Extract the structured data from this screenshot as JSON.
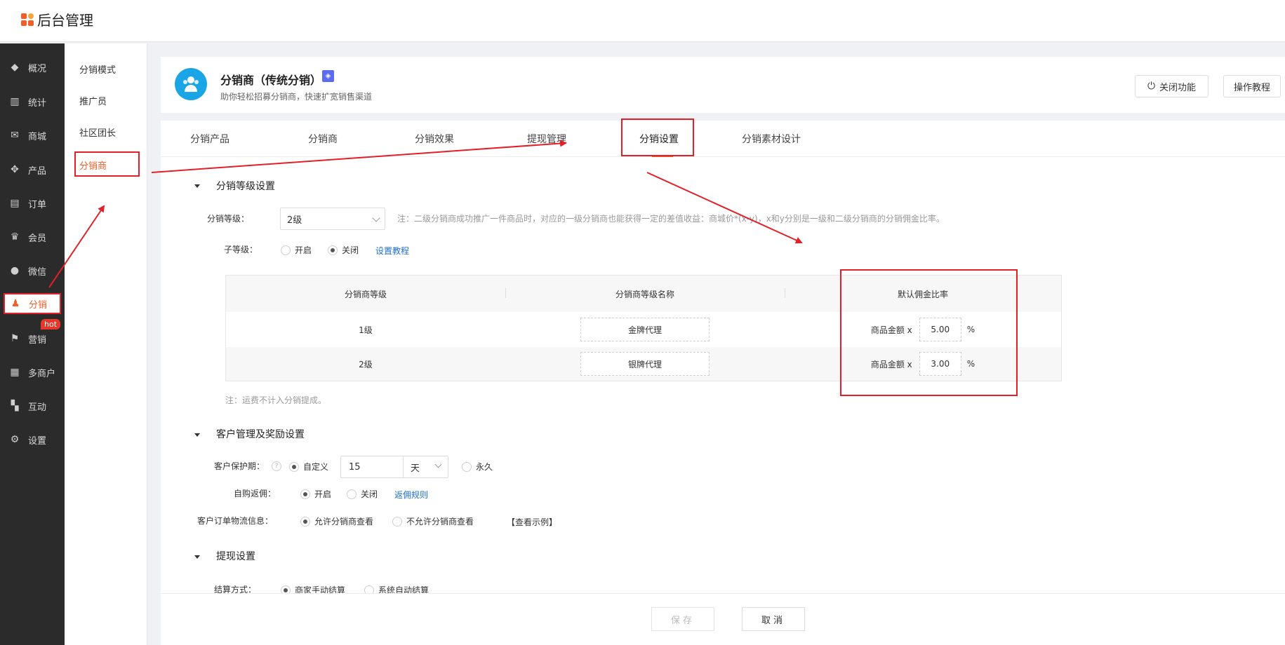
{
  "app": {
    "title": "后台管理"
  },
  "sidebar": {
    "items": [
      {
        "label": "概况",
        "icon": "layers-icon"
      },
      {
        "label": "统计",
        "icon": "chart-icon"
      },
      {
        "label": "商城",
        "icon": "mail-icon"
      },
      {
        "label": "产品",
        "icon": "grid-icon"
      },
      {
        "label": "订单",
        "icon": "order-icon"
      },
      {
        "label": "会员",
        "icon": "crown-icon"
      },
      {
        "label": "微信",
        "icon": "wechat-icon"
      },
      {
        "label": "分销",
        "icon": "user-icon"
      },
      {
        "label": "营销",
        "icon": "flag-icon"
      },
      {
        "label": "多商户",
        "icon": "store-icon"
      },
      {
        "label": "互动",
        "icon": "apps-icon"
      },
      {
        "label": "设置",
        "icon": "gear-icon"
      }
    ],
    "hot_badge": "hot"
  },
  "submenu": {
    "items": [
      "分销模式",
      "推广员",
      "社区团长",
      "分销商"
    ]
  },
  "head": {
    "title": "分销商（传统分销）",
    "subtitle": "助你轻松招募分销商，快速扩宽销售渠道",
    "close_button": "关闭功能",
    "guide_button": "操作教程"
  },
  "tabs": [
    "分销产品",
    "分销商",
    "分销效果",
    "提现管理",
    "分销设置",
    "分销素材设计"
  ],
  "level_section": {
    "title": "分销等级设置",
    "level_label": "分销等级：",
    "level_value": "2级",
    "level_note": "注：二级分销商成功推广一件商品时，对应的一级分销商也能获得一定的差值收益：商城价*(x-y)，x和y分别是一级和二级分销商的分销佣金比率。",
    "sub_label": "子等级：",
    "sub_on": "开启",
    "sub_off": "关闭",
    "sub_link": "设置教程",
    "table": {
      "headers": [
        "分销商等级",
        "分销商等级名称",
        "默认佣金比率"
      ],
      "rows": [
        {
          "level": "1级",
          "name": "金牌代理",
          "prefix": "商品金额 x",
          "rate": "5.00",
          "unit": "%"
        },
        {
          "level": "2级",
          "name": "银牌代理",
          "prefix": "商品金额 x",
          "rate": "3.00",
          "unit": "%"
        }
      ]
    },
    "footnote": "注：运费不计入分销提成。"
  },
  "customer_section": {
    "title": "客户管理及奖励设置",
    "protect_label": "客户保护期：",
    "protect_q": "?",
    "protect_custom": "自定义",
    "protect_days": "15",
    "protect_unit": "天",
    "protect_forever": "永久",
    "rebate_label": "自购返佣：",
    "rebate_on": "开启",
    "rebate_off": "关闭",
    "rebate_link": "返佣规则",
    "logistics_label": "客户订单物流信息：",
    "logistics_allow": "允许分销商查看",
    "logistics_deny": "不允许分销商查看",
    "logistics_example": "【查看示例】"
  },
  "withdraw_section": {
    "title": "提现设置",
    "settle_label": "结算方式：",
    "settle_manual": "商家手动结算",
    "settle_auto": "系统自动结算"
  },
  "footer": {
    "save": "保存",
    "cancel": "取消"
  },
  "colors": {
    "accent": "#f25d2a",
    "annotation_red": "#e2202a",
    "link": "#1f6fd1",
    "sidebar_bg": "#2b2b2b"
  }
}
